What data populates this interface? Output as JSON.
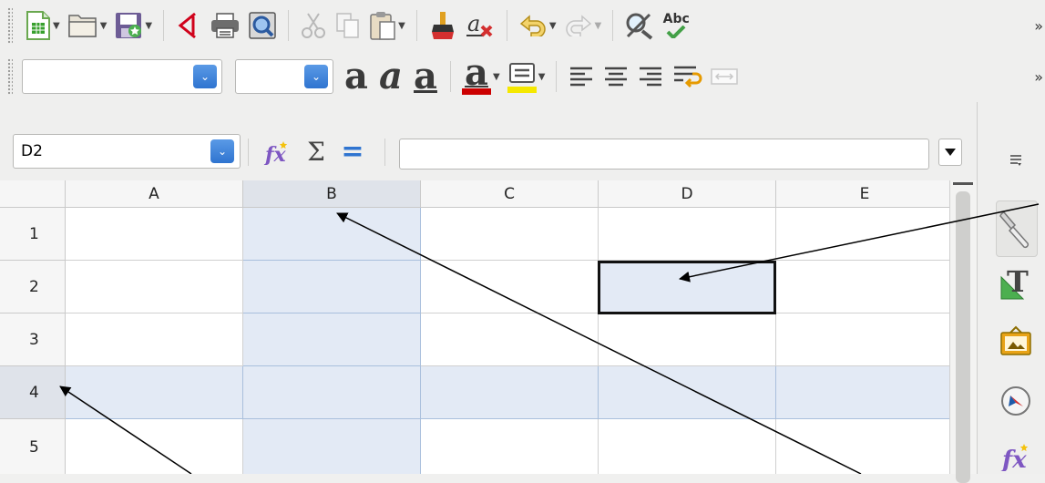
{
  "toolbar1": {
    "icons": [
      "new-spreadsheet-icon",
      "open-folder-icon",
      "save-icon",
      "export-pdf-icon",
      "print-icon",
      "print-preview-icon",
      "cut-icon",
      "copy-icon",
      "paste-icon",
      "clone-formatting-icon",
      "clear-formatting-icon",
      "undo-icon",
      "redo-icon",
      "find-replace-icon",
      "spelling-icon"
    ],
    "spelling_label": "Abc",
    "overflow": "»"
  },
  "toolbar2": {
    "font_name": "",
    "font_size": "",
    "bold_glyph": "a",
    "italic_glyph": "a",
    "underline_glyph": "a",
    "font_color_glyph": "a",
    "font_color": "#cc0000",
    "highlight_color": "#f5e800",
    "overflow": "»"
  },
  "formula_bar": {
    "name_box": "D2",
    "formula": "",
    "sum_glyph": "Σ",
    "equals_glyph": "="
  },
  "grid": {
    "columns": [
      "A",
      "B",
      "C",
      "D",
      "E"
    ],
    "rows": [
      "1",
      "2",
      "3",
      "4",
      "5"
    ],
    "selected_column": "B",
    "selected_row": "4",
    "active_cell": "D2",
    "highlight_color": "#e3eaf5"
  },
  "sidebar": {
    "icons": [
      "sidebar-menu-icon",
      "properties-icon",
      "styles-icon",
      "gallery-icon",
      "navigator-icon",
      "functions-icon"
    ]
  }
}
